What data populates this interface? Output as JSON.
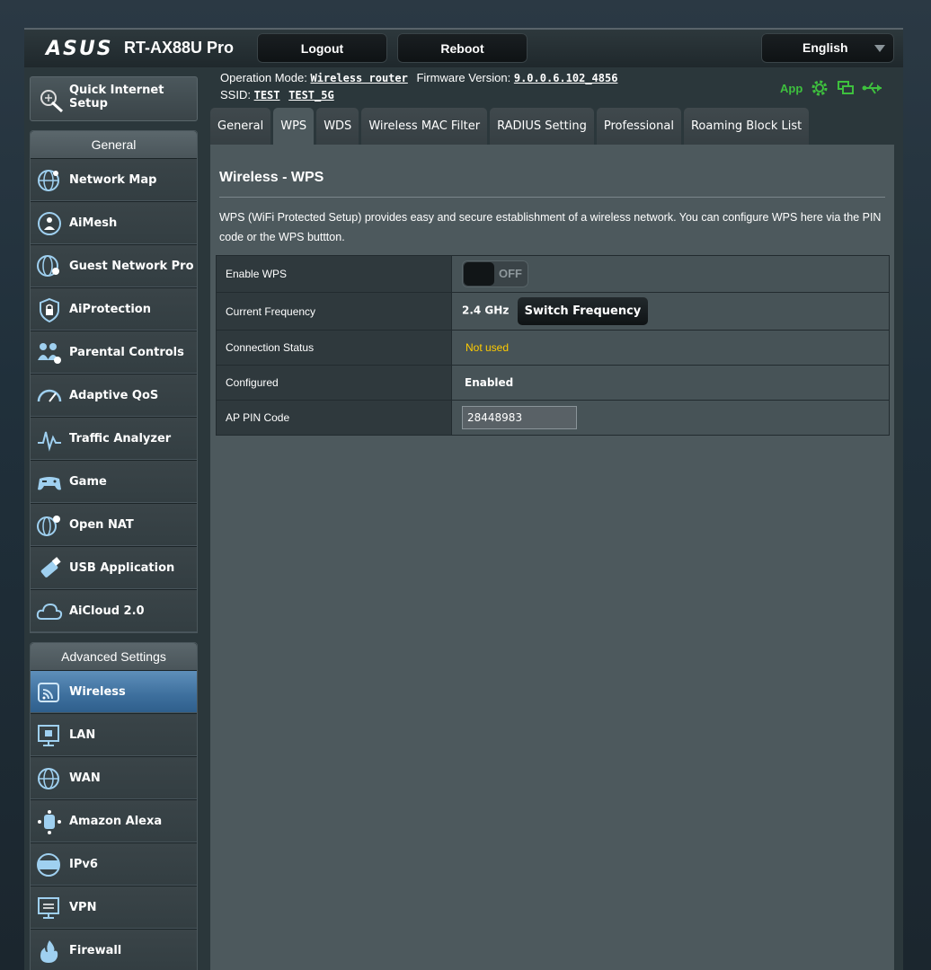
{
  "header": {
    "brand": "ASUS",
    "model": "RT-AX88U Pro",
    "logout_label": "Logout",
    "reboot_label": "Reboot",
    "language": "English"
  },
  "info": {
    "op_mode_label": "Operation Mode:",
    "op_mode_value": "Wireless router",
    "firmware_label": "Firmware Version:",
    "firmware_value": "9.0.0.6.102_4856",
    "ssid_label": "SSID:",
    "ssid_values": [
      "TEST",
      "TEST_5G"
    ],
    "app_label": "App"
  },
  "sidebar": {
    "quick_setup": "Quick Internet Setup",
    "general_head": "General",
    "general_items": [
      {
        "label": "Network Map",
        "icon": "globe-network-icon"
      },
      {
        "label": "AiMesh",
        "icon": "aimesh-icon"
      },
      {
        "label": "Guest Network Pro",
        "icon": "guest-network-icon"
      },
      {
        "label": "AiProtection",
        "icon": "shield-lock-icon"
      },
      {
        "label": "Parental Controls",
        "icon": "family-icon"
      },
      {
        "label": "Adaptive QoS",
        "icon": "speedometer-icon"
      },
      {
        "label": "Traffic Analyzer",
        "icon": "traffic-analyzer-icon"
      },
      {
        "label": "Game",
        "icon": "gamepad-icon"
      },
      {
        "label": "Open NAT",
        "icon": "open-nat-icon"
      },
      {
        "label": "USB Application",
        "icon": "usb-icon"
      },
      {
        "label": "AiCloud 2.0",
        "icon": "cloud-icon"
      }
    ],
    "advanced_head": "Advanced Settings",
    "advanced_items": [
      {
        "label": "Wireless",
        "icon": "wireless-icon"
      },
      {
        "label": "LAN",
        "icon": "lan-monitor-icon"
      },
      {
        "label": "WAN",
        "icon": "globe-icon"
      },
      {
        "label": "Amazon Alexa",
        "icon": "alexa-icon"
      },
      {
        "label": "IPv6",
        "icon": "ipv6-icon"
      },
      {
        "label": "VPN",
        "icon": "vpn-monitor-icon"
      },
      {
        "label": "Firewall",
        "icon": "fire-icon"
      }
    ]
  },
  "tabs": [
    "General",
    "WPS",
    "WDS",
    "Wireless MAC Filter",
    "RADIUS Setting",
    "Professional",
    "Roaming Block List"
  ],
  "active_tab": "WPS",
  "main": {
    "title": "Wireless - WPS",
    "description": "WPS (WiFi Protected Setup) provides easy and secure establishment of a wireless network. You can configure WPS here via the PIN code or the WPS buttton.",
    "rows": {
      "enable_wps_label": "Enable WPS",
      "enable_wps_state": "OFF",
      "current_freq_label": "Current Frequency",
      "current_freq_value": "2.4 GHz",
      "switch_freq_label": "Switch Frequency",
      "conn_status_label": "Connection Status",
      "conn_status_value": "Not used",
      "configured_label": "Configured",
      "configured_value": "Enabled",
      "pin_label": "AP PIN Code",
      "pin_value": "28448983"
    }
  },
  "colors": {
    "accent_blue": "#3d6f9d",
    "status_yellow": "#ffcc00",
    "app_green": "#3ec03e"
  }
}
